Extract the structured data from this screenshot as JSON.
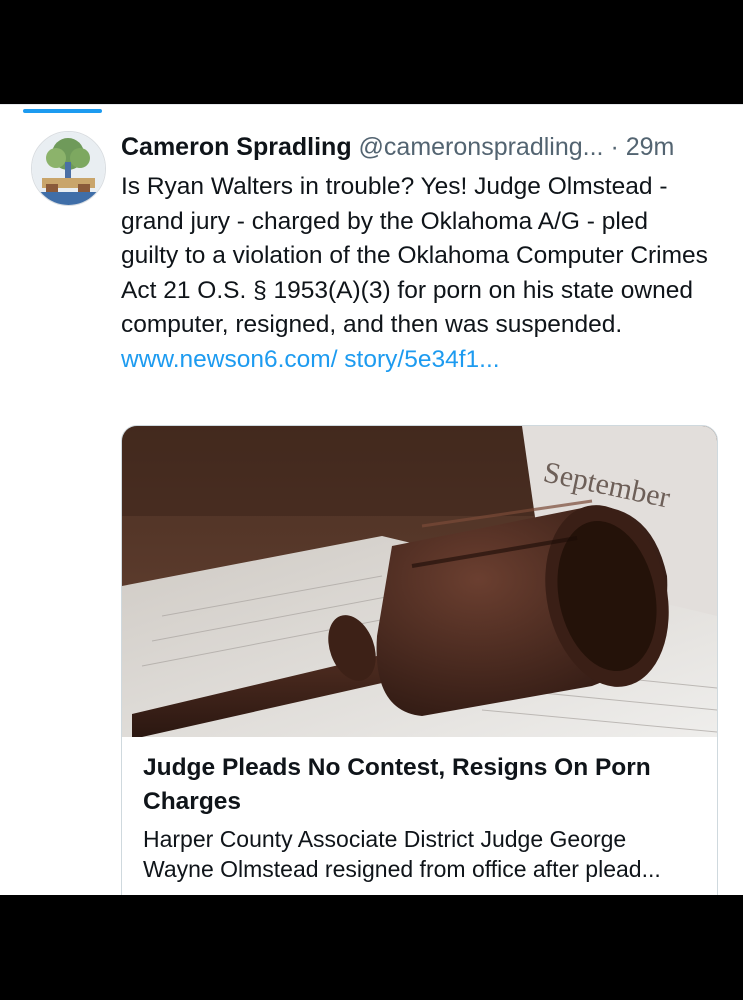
{
  "tweet": {
    "author_name": "Cameron Spradling",
    "handle": "@cameronspradling...",
    "separator": "·",
    "time": "29m",
    "text": "Is Ryan Walters in trouble? Yes! Judge Olmstead - grand jury - charged by the Oklahoma A/G - pled guilty to a violation of the Oklahoma Computer Crimes Act 21 O.S. § 1953(A)(3) for porn on his state owned computer, resigned, and then was suspended.",
    "link_text": "www.newson6.com/ story/5e34f1..."
  },
  "card": {
    "image_icon": "gavel-on-document-image",
    "image_visible_text": "September",
    "title": "Judge Pleads No Contest, Resigns On Porn Charges",
    "description": "Harper County Associate District Judge George Wayne Olmstead resigned from office after plead..."
  },
  "colors": {
    "accent": "#1d9bf0",
    "text": "#0f1419",
    "muted": "#536471",
    "border": "#cfd9de"
  }
}
